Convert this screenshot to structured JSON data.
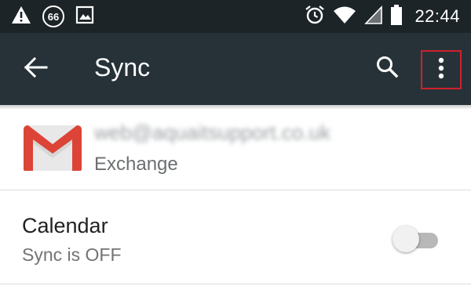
{
  "status_bar": {
    "notification_badge": "66",
    "time": "22:44",
    "icons": [
      "warning-icon",
      "badge-66-icon",
      "image-icon",
      "alarm-icon",
      "wifi-icon",
      "cell-signal-icon",
      "battery-icon"
    ]
  },
  "toolbar": {
    "title": "Sync",
    "back_icon": "arrow-left-icon",
    "search_icon": "search-icon",
    "overflow_icon": "more-vert-icon",
    "color": "#263238",
    "highlight_color": "#d0202a"
  },
  "account": {
    "email": "web@aquaitsupport.co.uk",
    "type": "Exchange",
    "icon": "gmail-icon"
  },
  "calendar": {
    "label": "Calendar",
    "status": "Sync is OFF",
    "enabled": false
  }
}
